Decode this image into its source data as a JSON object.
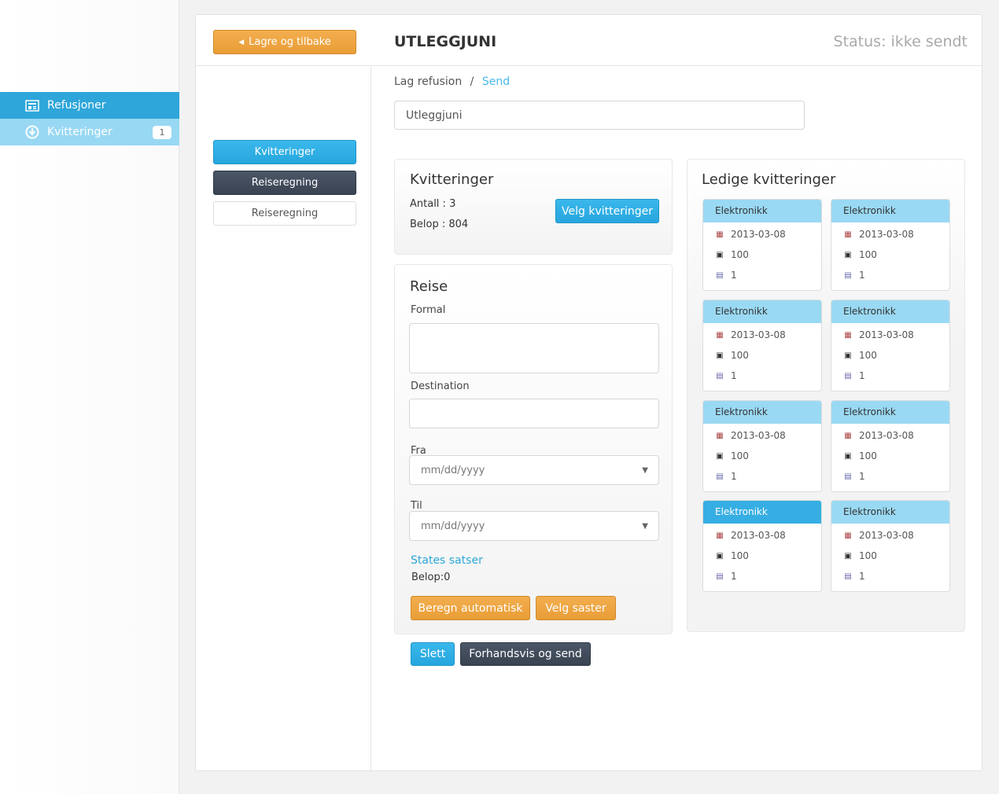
{
  "sidebar": {
    "items": [
      {
        "label": "Refusjoner",
        "icon": "newspaper-icon"
      },
      {
        "label": "Kvitteringer",
        "icon": "download-circle-icon",
        "badge": "1"
      }
    ]
  },
  "header": {
    "back_button": "Lagre og tilbake",
    "title": "UTLEGGJUNI",
    "status": "Status: ikke sendt"
  },
  "left_menu": {
    "items": [
      "Kvitteringer",
      "Reiseregning",
      "Reiseregning"
    ]
  },
  "breadcrumb": {
    "parent": "Lag refusion",
    "separator": "/",
    "current": "Send"
  },
  "name_input": {
    "value": "Utleggjuni"
  },
  "kvitteringer": {
    "title": "Kvitteringer",
    "antall": "Antall : 3",
    "belop": "Belop : 804",
    "button": "Velg kvitteringer"
  },
  "reise": {
    "title": "Reise",
    "formal_label": "Formal",
    "destination_label": "Destination",
    "fra_label": "Fra",
    "fra_placeholder": "mm/dd/yyyy",
    "til_label": "Til",
    "til_placeholder": "mm/dd/yyyy",
    "states_link": "States satser",
    "belop": "Belop:0",
    "beregn_button": "Beregn automatisk",
    "velg_button": "Velg saster"
  },
  "actions": {
    "slett": "Slett",
    "preview": "Forhandsvis og send"
  },
  "ledige": {
    "title": "Ledige kvitteringer",
    "cards": [
      {
        "category": "Elektronikk",
        "date": "2013-03-08",
        "amount": "100",
        "count": "1"
      },
      {
        "category": "Elektronikk",
        "date": "2013-03-08",
        "amount": "100",
        "count": "1"
      },
      {
        "category": "Elektronikk",
        "date": "2013-03-08",
        "amount": "100",
        "count": "1"
      },
      {
        "category": "Elektronikk",
        "date": "2013-03-08",
        "amount": "100",
        "count": "1"
      },
      {
        "category": "Elektronikk",
        "date": "2013-03-08",
        "amount": "100",
        "count": "1"
      },
      {
        "category": "Elektronikk",
        "date": "2013-03-08",
        "amount": "100",
        "count": "1"
      },
      {
        "category": "Elektronikk",
        "date": "2013-03-08",
        "amount": "100",
        "count": "1",
        "selected": true
      },
      {
        "category": "Elektronikk",
        "date": "2013-03-08",
        "amount": "100",
        "count": "1"
      }
    ]
  },
  "colors": {
    "primary": "#2ea6da",
    "light_blue": "#9ad9f3",
    "orange": "#eea546",
    "dark": "#3f4858"
  }
}
